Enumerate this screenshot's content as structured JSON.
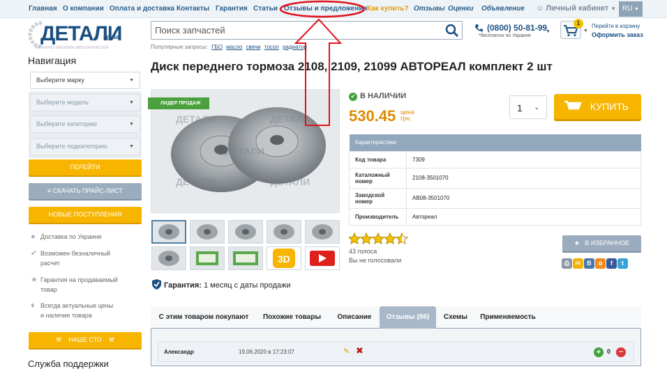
{
  "topnav": {
    "items": [
      "Главная",
      "О компании",
      "Оплата и доставка",
      "Контакты",
      "Гарантия",
      "Статьи",
      "Отзывы и предложения",
      "Как купить?",
      "Отзывы",
      "Оценки",
      "Объявление"
    ],
    "account": "Личный кабинет",
    "lang": "RU"
  },
  "logo": {
    "main": "ДЕТАЛИ",
    "zp": "zp.ua",
    "tagline": "ИНТЕРНЕТ-МАГАЗИН АВТОЗАПЧАСТЕЙ"
  },
  "search": {
    "placeholder": "Поиск запчастей",
    "popular_label": "Популярные запросы:",
    "popular": [
      "ГБО",
      "масло",
      "свечи",
      "тосол",
      "радиатор"
    ]
  },
  "contact": {
    "phone": "(0800) 50-81-99",
    "free": "*бесплатно по Украине"
  },
  "cart": {
    "count": "1",
    "goto": "Перейти в корзину",
    "checkout": "Оформить заказ"
  },
  "sidebar": {
    "title": "Навигация",
    "selects": [
      "Выберите марку",
      "Выберите модель",
      "Выберите категорию",
      "Выберите подкатегорию"
    ],
    "go": "ПЕРЕЙТИ",
    "price_list": "СКАЧАТЬ ПРАЙС-ЛИСТ",
    "new": "НОВЫЕ ПОСТУПЛЕНИЯ",
    "features": [
      {
        "l1": "Доставка по Украине",
        "l2": ""
      },
      {
        "l1": "Возможен безналичный",
        "l2": "расчет"
      },
      {
        "l1": "Гарантия на продаваемый",
        "l2": "товар"
      },
      {
        "l1": "Всегда актуальные цены",
        "l2": "и наличие товара"
      }
    ],
    "our_sto": "НАШЕ СТО",
    "support": "Служба поддержки"
  },
  "product": {
    "title": "Диск переднего тормоза 2108, 2109, 21099 АВТОРЕАЛ комплект 2 шт",
    "leader": "ЛИДЕР ПРОДАЖ",
    "watermark": "ДЕТАЛИ",
    "stock": "В НАЛИЧИИ",
    "price": "530.45",
    "price_label": "цена",
    "currency": "грн.",
    "qty": "1",
    "buy": "КУПИТЬ",
    "specs_header": "Характеристики",
    "specs": [
      {
        "k": "Код товара",
        "v": "7309"
      },
      {
        "k": "Каталожный номер",
        "v": "2108-3501070"
      },
      {
        "k": "Заводской номер",
        "v": "AB08-3501070"
      },
      {
        "k": "Производитель",
        "v": "Автореал"
      }
    ],
    "rating": 4.5,
    "votes": "43 голоса",
    "not_voted": "Вы не голосовали",
    "favorite": "В ИЗБРАННОЕ",
    "guarantee_label": "Гарантия:",
    "guarantee": "1 месяц с даты продажи"
  },
  "tabs": [
    "С этим товаром покупают",
    "Похожие товары",
    "Описание",
    "Отзывы (86)",
    "Схемы",
    "Применяемость"
  ],
  "review": {
    "name": "Александр",
    "date": "19.06.2020 в 17:23:07",
    "score": "0"
  },
  "colors": {
    "brand": "#1a4f80",
    "accent": "#f7b500",
    "annotation": "#e0101a"
  }
}
